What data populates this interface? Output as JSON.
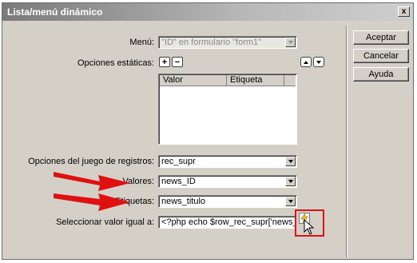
{
  "window": {
    "title": "Lista/menú dinámico",
    "close_label": "x"
  },
  "form": {
    "menu_label": "Menú:",
    "menu_value": "\"ID\" en formulario \"form1\"",
    "static_options_label": "Opciones estáticas:",
    "add_symbol": "+",
    "remove_symbol": "−",
    "columns": [
      "Valor",
      "Etiqueta"
    ],
    "recordset_label": "Opciones del juego de registros:",
    "recordset_value": "rec_supr",
    "values_label": "Valores:",
    "values_value": "news_ID",
    "labels_label": "Etiquetas:",
    "labels_value": "news_titulo",
    "select_equal_label": "Seleccionar valor igual a:",
    "select_equal_value": "<?php echo $row_rec_supr['news_titulo"
  },
  "buttons": {
    "accept": "Aceptar",
    "cancel": "Cancelar",
    "help": "Ayuda"
  },
  "icons": {
    "dynamic_data": "lightning-bolt-icon",
    "cursor": "mouse-pointer-icon",
    "annotation_arrows": "red-arrow-icon"
  },
  "colors": {
    "annotation": "#e01010",
    "titlebar": "#8a8a8a",
    "dialog_bg": "#d4d0c8"
  }
}
